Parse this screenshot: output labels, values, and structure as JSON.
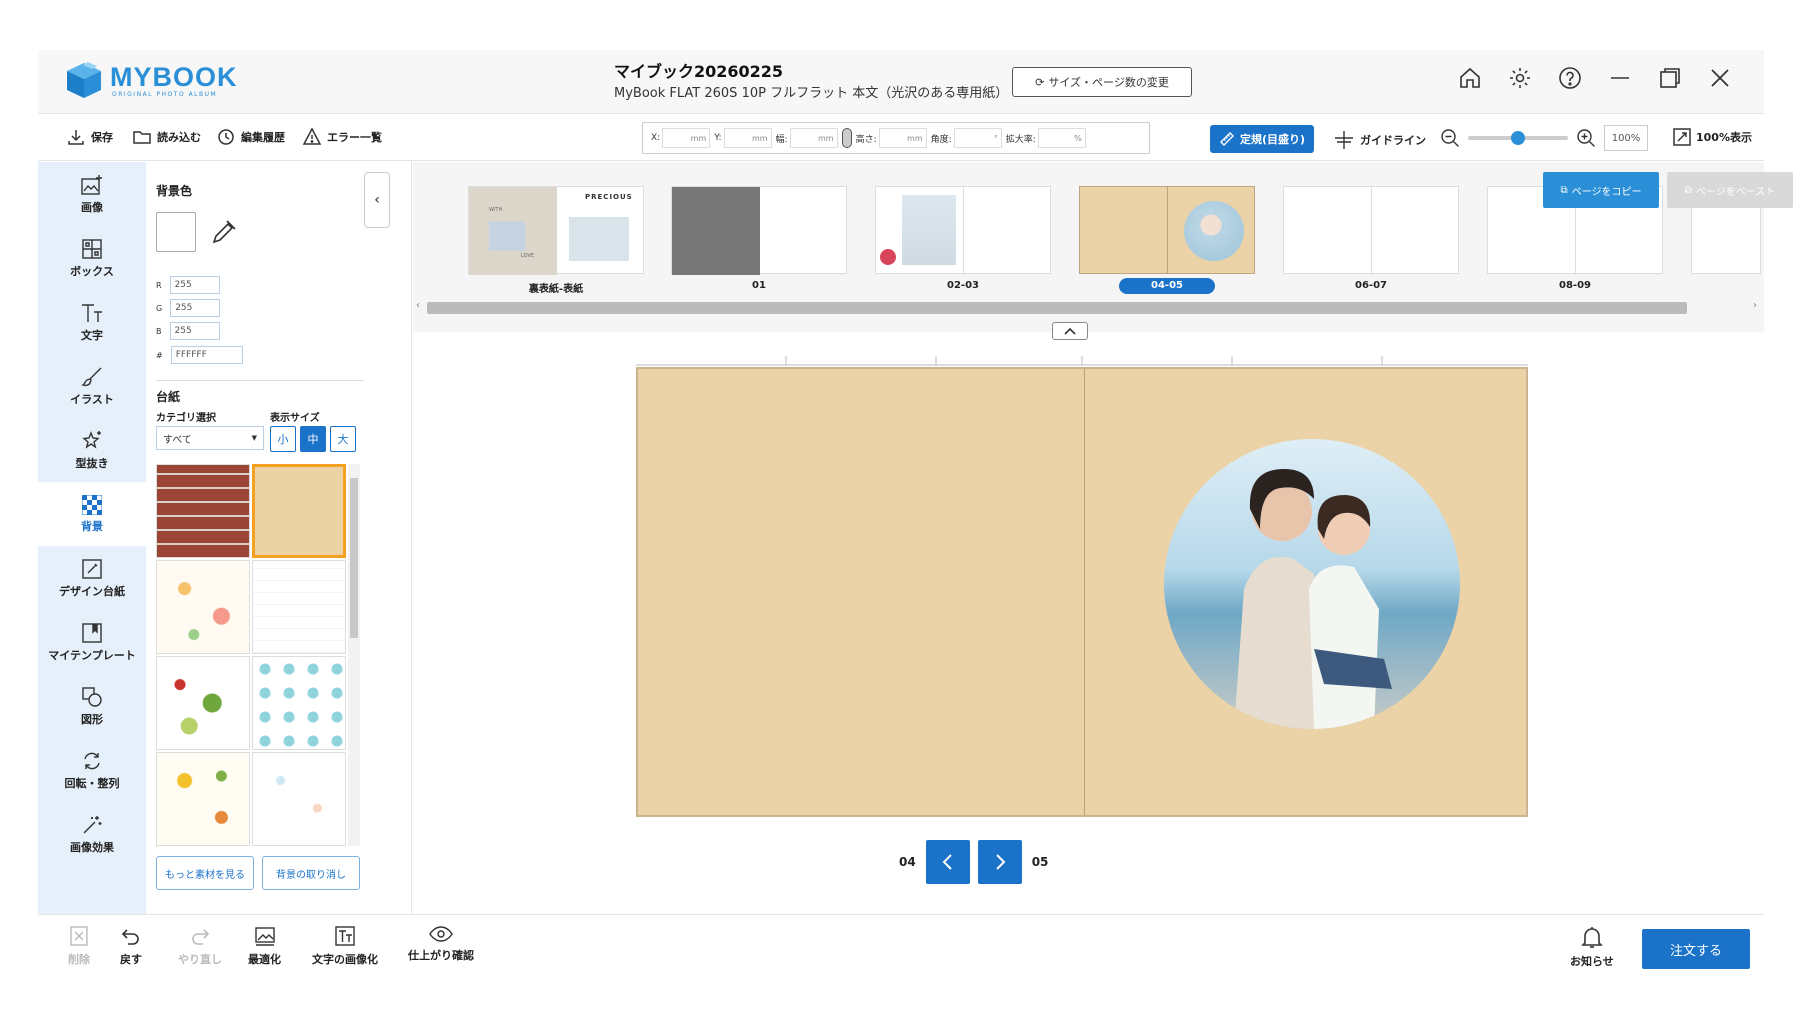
{
  "app": {
    "logo_name": "MYBOOK",
    "logo_sub": "ORIGINAL PHOTO ALBUM"
  },
  "header": {
    "title": "マイブック20260225",
    "subtitle": "MyBook FLAT 260S 10P フルフラット 本文（光沢のある専用紙）",
    "size_button": "サイズ・ページ数の変更",
    "icons": [
      "home-icon",
      "gear-icon",
      "help-icon",
      "minimize-icon",
      "restore-icon",
      "close-icon"
    ]
  },
  "toolbar": {
    "save": "保存",
    "load": "読み込む",
    "history": "編集履歴",
    "errors": "エラー一覧",
    "fields": [
      {
        "label": "X:",
        "unit": "mm"
      },
      {
        "label": "Y:",
        "unit": "mm"
      },
      {
        "label": "幅:",
        "unit": "mm"
      },
      {
        "label": "高さ:",
        "unit": "mm"
      },
      {
        "label": "角度:",
        "unit": "°"
      },
      {
        "label": "拡大率:",
        "unit": "%"
      }
    ],
    "ruler_button": "定規(目盛り)",
    "guideline": "ガイドライン",
    "zoom_value": "100%",
    "zoom_level": 0.5,
    "fit_button": "100%表示"
  },
  "leftnav": [
    {
      "label": "画像",
      "icon": "image-add-icon"
    },
    {
      "label": "ボックス",
      "icon": "box-layout-icon"
    },
    {
      "label": "文字",
      "icon": "text-icon"
    },
    {
      "label": "イラスト",
      "icon": "brush-icon"
    },
    {
      "label": "型抜き",
      "icon": "star-cut-icon"
    },
    {
      "label": "背景",
      "icon": "checker-icon",
      "active": true
    },
    {
      "label": "デザイン台紙",
      "icon": "design-mount-icon"
    },
    {
      "label": "マイテンプレート",
      "icon": "template-icon"
    },
    {
      "label": "図形",
      "icon": "shapes-icon"
    },
    {
      "label": "回転・整列",
      "icon": "rotate-icon"
    },
    {
      "label": "画像効果",
      "icon": "magic-wand-icon"
    }
  ],
  "panel": {
    "bg_color_title": "背景色",
    "r_label": "R",
    "r": "255",
    "g_label": "G",
    "g": "255",
    "b_label": "B",
    "b": "255",
    "hex_label": "#",
    "hex": "FFFFFF",
    "mount_title": "台紙",
    "category_label": "カテゴリ選択",
    "category_value": "すべて",
    "display_size_label": "表示サイズ",
    "sizes": [
      "小",
      "中",
      "大"
    ],
    "more_button": "もっと素材を見る",
    "cancel_bg_button": "背景の取り消し"
  },
  "pages": {
    "thumbs": [
      {
        "label": "裏表紙-表紙"
      },
      {
        "label": "01"
      },
      {
        "label": "02-03"
      },
      {
        "label": "04-05",
        "active": true
      },
      {
        "label": "06-07"
      },
      {
        "label": "08-09"
      }
    ],
    "cover_text": "PRECIOUS",
    "cover_text2": "WITH",
    "cover_text3": "LOVE",
    "copy_button": "ページをコピー",
    "paste_button": "ページをペースト"
  },
  "canvas": {
    "left_page": "04",
    "right_page": "05"
  },
  "bottombar": {
    "delete": "削除",
    "undo": "戻す",
    "redo": "やり直し",
    "optimize": "最適化",
    "text_to_image": "文字の画像化",
    "preview": "仕上がり確認",
    "notice": "お知らせ",
    "order": "注文する"
  },
  "colors": {
    "accent": "#1a73c9",
    "brand": "#2a8fd6",
    "paper": "#ebd2a7",
    "selected_tile": "#f4a020"
  }
}
